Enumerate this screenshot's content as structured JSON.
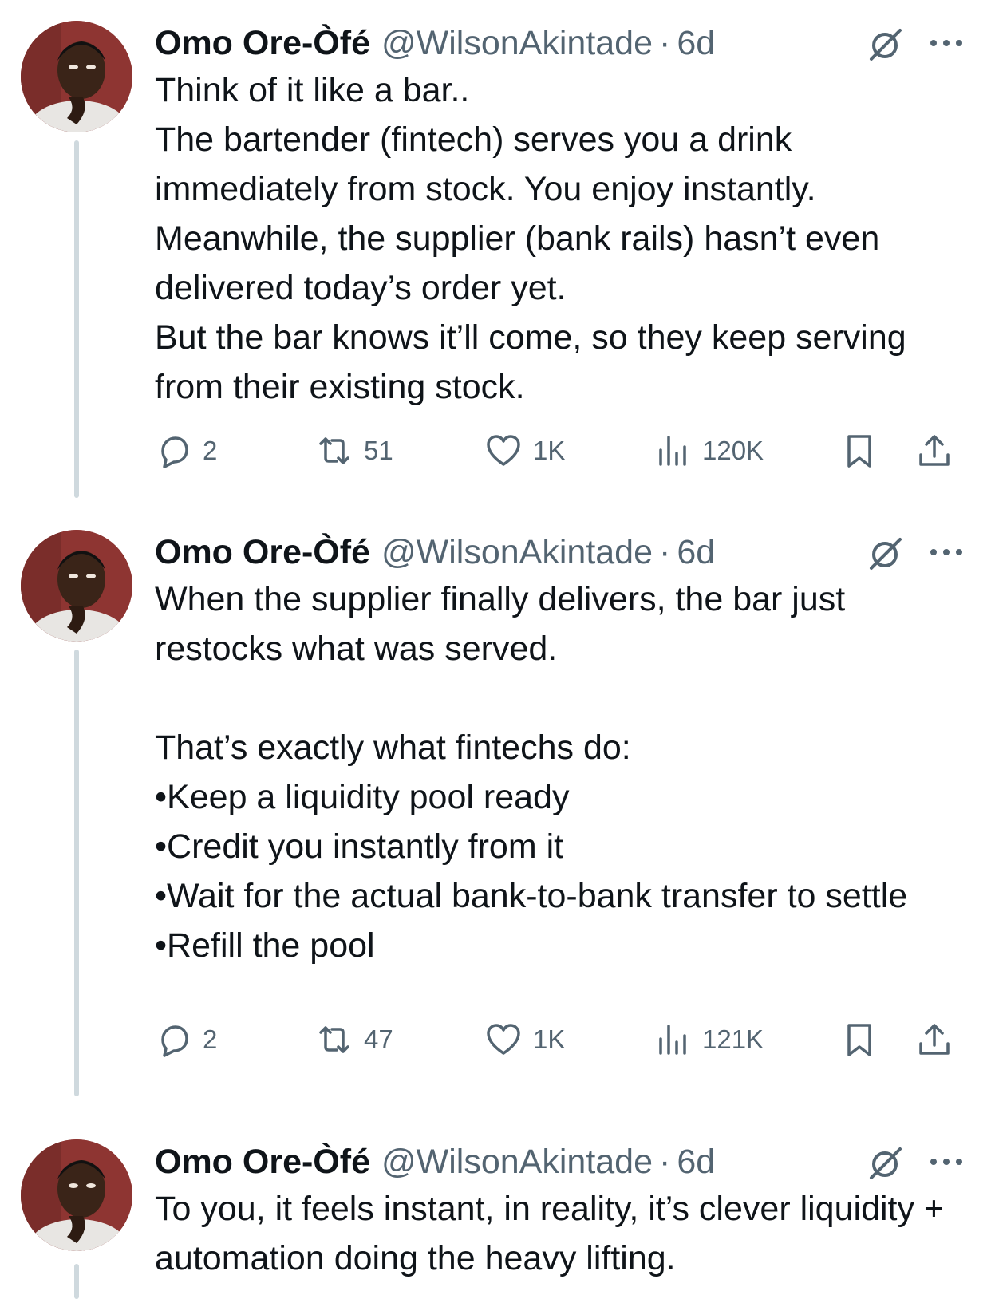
{
  "tweets": [
    {
      "author_name": "Omo Ore-Òfé",
      "handle": "@WilsonAkintade",
      "separator": "·",
      "time": "6d",
      "lines": [
        "Think of it like a bar..",
        "The bartender (fintech) serves you a drink immediately from stock. You enjoy instantly.",
        "Meanwhile, the supplier (bank rails) hasn’t even delivered today’s order yet.",
        "But the bar knows it’ll come, so they keep serving from their existing stock."
      ],
      "replies": "2",
      "reposts": "51",
      "likes": "1K",
      "views": "120K"
    },
    {
      "author_name": "Omo Ore-Òfé",
      "handle": "@WilsonAkintade",
      "separator": "·",
      "time": "6d",
      "lines": [
        "When the supplier finally delivers, the bar just restocks what was served.",
        "",
        "That’s exactly what fintechs do:",
        "•Keep a liquidity pool ready",
        "•Credit you instantly from it",
        "•Wait for the actual bank-to-bank transfer to settle",
        "•Refill the pool"
      ],
      "replies": "2",
      "reposts": "47",
      "likes": "1K",
      "views": "121K"
    },
    {
      "author_name": "Omo Ore-Òfé",
      "handle": "@WilsonAkintade",
      "separator": "·",
      "time": "6d",
      "lines": [
        "To you, it feels instant, in reality, it’s clever liquidity + automation doing the heavy lifting."
      ]
    }
  ],
  "icons": {
    "avatar": "profile-photo",
    "grok": "grok-icon",
    "more": "more-icon",
    "reply": "reply-icon",
    "repost": "repost-icon",
    "like": "heart-icon",
    "views": "views-icon",
    "bookmark": "bookmark-icon",
    "share": "share-icon"
  },
  "colors": {
    "text": "#0f1419",
    "secondary": "#536471",
    "thread_line": "#cfd9de",
    "background": "#ffffff"
  }
}
